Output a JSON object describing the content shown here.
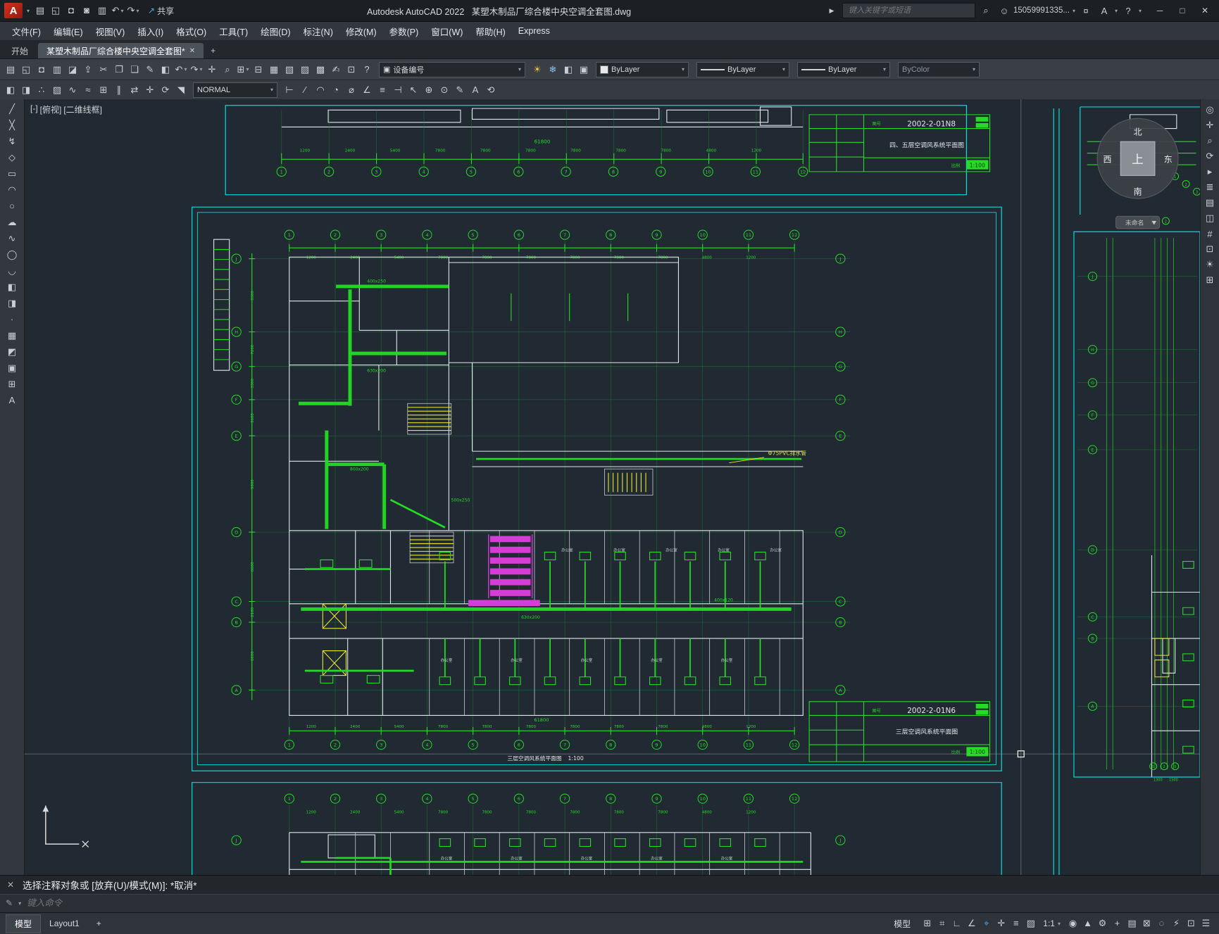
{
  "ui": {
    "caret": "▾",
    "collapse": "▶",
    "close": "✕"
  },
  "titlebar": {
    "logo": "A",
    "app": "Autodesk AutoCAD 2022",
    "doc": "某塑木制品厂综合楼中央空调全套图.dwg",
    "share_icon": "↗",
    "share_label": "共享",
    "search_placeholder": "键入关键字或短语",
    "user": "15059991335...",
    "icons": {
      "search": "⌕",
      "user": "☺",
      "cart": "¤",
      "app": "A",
      "help": "?"
    },
    "quick_icons": [
      {
        "name": "new-icon",
        "glyph": "▤"
      },
      {
        "name": "open-folder-icon",
        "glyph": "◱"
      },
      {
        "name": "save-icon",
        "glyph": "◘"
      },
      {
        "name": "save-as-icon",
        "glyph": "◙"
      },
      {
        "name": "plot-icon",
        "glyph": "▥"
      },
      {
        "name": "undo-icon",
        "glyph": "↶",
        "drop": "▾"
      },
      {
        "name": "redo-icon",
        "glyph": "↷",
        "drop": "▾"
      }
    ],
    "window_controls": [
      {
        "name": "minimize-button",
        "glyph": "─"
      },
      {
        "name": "maximize-button",
        "glyph": "□"
      },
      {
        "name": "close-button",
        "glyph": "✕"
      }
    ]
  },
  "menus": [
    "文件(F)",
    "编辑(E)",
    "视图(V)",
    "插入(I)",
    "格式(O)",
    "工具(T)",
    "绘图(D)",
    "标注(N)",
    "修改(M)",
    "参数(P)",
    "窗口(W)",
    "帮助(H)",
    "Express"
  ],
  "tabs": {
    "start": "开始",
    "doc": "某塑木制品厂综合楼中央空调全套图*",
    "plus": "+"
  },
  "toolbar1": {
    "icons": [
      {
        "name": "qnew-icon",
        "glyph": "▤"
      },
      {
        "name": "open-icon",
        "glyph": "◱"
      },
      {
        "name": "save-icon",
        "glyph": "◘"
      },
      {
        "name": "plot-icon",
        "glyph": "▥"
      },
      {
        "name": "plot-preview-icon",
        "glyph": "◪"
      },
      {
        "name": "publish-icon",
        "glyph": "⇪"
      },
      {
        "name": "cut-icon",
        "glyph": "✂"
      },
      {
        "name": "copy-icon",
        "glyph": "❐"
      },
      {
        "name": "paste-icon",
        "glyph": "❏"
      },
      {
        "name": "match-properties-icon",
        "glyph": "✎"
      },
      {
        "name": "block-editor-icon",
        "glyph": "◧"
      },
      {
        "name": "undo-icon",
        "glyph": "↶",
        "drop": "▾"
      },
      {
        "name": "redo-icon",
        "glyph": "↷",
        "drop": "▾"
      },
      {
        "name": "pan-icon",
        "glyph": "✛"
      },
      {
        "name": "zoom-realtime-icon",
        "glyph": "⌕"
      },
      {
        "name": "zoom-window-icon",
        "glyph": "⊞",
        "drop": "▾"
      },
      {
        "name": "zoom-previous-icon",
        "glyph": "⊟"
      },
      {
        "name": "properties-icon",
        "glyph": "▦"
      },
      {
        "name": "design-center-icon",
        "glyph": "▧"
      },
      {
        "name": "tool-palettes-icon",
        "glyph": "▨"
      },
      {
        "name": "sheet-set-manager-icon",
        "glyph": "▩"
      },
      {
        "name": "markup-set-manager-icon",
        "glyph": "✍"
      },
      {
        "name": "quickcalc-icon",
        "glyph": "⊡"
      },
      {
        "name": "help-icon",
        "glyph": "?"
      }
    ],
    "equipment_icon": "▣",
    "equipment_label": "设备编号",
    "layer_icons": [
      {
        "name": "layer-on-icon",
        "glyph": "☀",
        "color": "#e8c63a"
      },
      {
        "name": "layer-freeze-icon",
        "glyph": "❄",
        "color": "#8cc4ee"
      },
      {
        "name": "layer-lock-icon",
        "glyph": "◧"
      },
      {
        "name": "layer-color-icon",
        "glyph": "▣"
      }
    ],
    "color_value": "ByLayer",
    "linetype_value": "ByLayer",
    "lineweight_value": "ByLayer",
    "plotstyle_value": "ByColor"
  },
  "toolbar2": {
    "icons_a": [
      {
        "name": "insert-block-icon",
        "glyph": "◧"
      },
      {
        "name": "make-block-icon",
        "glyph": "◨"
      },
      {
        "name": "point-style-icon",
        "glyph": "∴"
      },
      {
        "name": "hatch-icon",
        "glyph": "▨"
      },
      {
        "name": "polyline-edit-icon",
        "glyph": "∿"
      },
      {
        "name": "spline-edit-icon",
        "glyph": "≈"
      },
      {
        "name": "array-icon",
        "glyph": "⊞"
      },
      {
        "name": "offset-icon",
        "glyph": "∥"
      },
      {
        "name": "mirror-icon",
        "glyph": "⇄"
      },
      {
        "name": "move-icon",
        "glyph": "✛"
      },
      {
        "name": "rotate-icon",
        "glyph": "⟳"
      },
      {
        "name": "scale-icon",
        "glyph": "◥"
      }
    ],
    "style_value": "NORMAL",
    "icons_b": [
      {
        "name": "dim-linear-icon",
        "glyph": "⊢"
      },
      {
        "name": "dim-aligned-icon",
        "glyph": "∕"
      },
      {
        "name": "dim-arc-icon",
        "glyph": "◠"
      },
      {
        "name": "dim-radius-icon",
        "glyph": "◔"
      },
      {
        "name": "dim-diameter-icon",
        "glyph": "⌀"
      },
      {
        "name": "dim-angular-icon",
        "glyph": "∠"
      },
      {
        "name": "dim-baseline-icon",
        "glyph": "≡"
      },
      {
        "name": "dim-continue-icon",
        "glyph": "⊣"
      },
      {
        "name": "mleader-icon",
        "glyph": "↖"
      },
      {
        "name": "tolerance-icon",
        "glyph": "⊕"
      },
      {
        "name": "center-mark-icon",
        "glyph": "⊙"
      },
      {
        "name": "dim-edit-icon",
        "glyph": "✎"
      },
      {
        "name": "text-edit-icon",
        "glyph": "A"
      },
      {
        "name": "dim-update-icon",
        "glyph": "⟲"
      }
    ]
  },
  "left_tools": [
    {
      "name": "line-icon",
      "glyph": "╱"
    },
    {
      "name": "construction-line-icon",
      "glyph": "╳"
    },
    {
      "name": "polyline-icon",
      "glyph": "↯"
    },
    {
      "name": "polygon-icon",
      "glyph": "◇"
    },
    {
      "name": "rectangle-icon",
      "glyph": "▭"
    },
    {
      "name": "arc-icon",
      "glyph": "◠"
    },
    {
      "name": "circle-icon",
      "glyph": "○"
    },
    {
      "name": "revcloud-icon",
      "glyph": "☁"
    },
    {
      "name": "spline-icon",
      "glyph": "∿"
    },
    {
      "name": "ellipse-icon",
      "glyph": "◯"
    },
    {
      "name": "ellipse-arc-icon",
      "glyph": "◡"
    },
    {
      "name": "insert-block-icon",
      "glyph": "◧"
    },
    {
      "name": "make-block-icon",
      "glyph": "◨"
    },
    {
      "name": "point-icon",
      "glyph": "·"
    },
    {
      "name": "hatch-icon",
      "glyph": "▦"
    },
    {
      "name": "gradient-icon",
      "glyph": "◩"
    },
    {
      "name": "region-icon",
      "glyph": "▣"
    },
    {
      "name": "table-icon",
      "glyph": "⊞"
    },
    {
      "name": "mtext-icon",
      "glyph": "A"
    }
  ],
  "right_tools": [
    {
      "name": "navigation-wheel-icon",
      "glyph": "◎"
    },
    {
      "name": "pan-icon",
      "glyph": "✛"
    },
    {
      "name": "zoom-extents-icon",
      "glyph": "⌕"
    },
    {
      "name": "orbit-icon",
      "glyph": "⟳"
    },
    {
      "name": "show-motion-icon",
      "glyph": "▸"
    },
    {
      "name": "layers-panel-icon",
      "glyph": "≣"
    },
    {
      "name": "properties-panel-icon",
      "glyph": "▤"
    },
    {
      "name": "blocks-panel-icon",
      "glyph": "◫"
    },
    {
      "name": "count-icon",
      "glyph": "#"
    },
    {
      "name": "views-icon",
      "glyph": "⊡"
    },
    {
      "name": "sun-icon",
      "glyph": "☀"
    },
    {
      "name": "grid-panel-icon",
      "glyph": "⊞"
    }
  ],
  "viewport_controls": {
    "min": "[-]",
    "view": "[俯视]",
    "style": "[二维线框]"
  },
  "viewcube": {
    "n": "北",
    "s": "南",
    "w": "西",
    "e": "东",
    "up": "上",
    "view_name": "未命名"
  },
  "drawing": {
    "grid_cols": [
      "1",
      "2",
      "3",
      "4",
      "5",
      "6",
      "7",
      "8",
      "9",
      "10",
      "11",
      "12"
    ],
    "grid_rows": [
      "J",
      "H",
      "G",
      "F",
      "E",
      "D",
      "C",
      "B",
      "A"
    ],
    "row_j": [
      "J"
    ],
    "pair": [
      "1",
      "2"
    ],
    "trio": [
      "1",
      "2",
      "3"
    ],
    "dims_cols": [
      "1200",
      "2400",
      "5400",
      "7800",
      "7800",
      "7800",
      "7800",
      "7800",
      "7800",
      "4800",
      "1200"
    ],
    "dims_total": "61800",
    "dims_rows": [
      "3300",
      "7200",
      "3300",
      "3600",
      "9000",
      "6600",
      "2100",
      "6600"
    ],
    "dims_mini": [
      "1300",
      "1500"
    ],
    "offices": [
      "办公室",
      "办公室",
      "办公室",
      "办公室",
      "办公室"
    ],
    "duct_tags": [
      "400x250",
      "630x200",
      "800x200",
      "500x250",
      "630x200",
      "400x120"
    ],
    "pvc_note": "Φ75PVC排水管",
    "titleblock1": {
      "no_label": "图号",
      "no": "2002-2-01N8",
      "title": "四、五层空调风系统平面图",
      "scale_label": "比例",
      "scale": "1:100"
    },
    "titleblock2": {
      "no_label": "图号",
      "no": "2002-2-01N6",
      "title": "三层空调风系统平面图",
      "scale_label": "比例",
      "scale": "1:100"
    }
  },
  "command": {
    "history": "选择注释对象或 [放弃(U)/模式(M)]: *取消*",
    "prompt": "键入命令",
    "tool_icon": "✎"
  },
  "statusbar": {
    "model_tab": "模型",
    "layout_tab": "Layout1",
    "plus": "+",
    "model_btn": "模型",
    "scale": "1:1",
    "icons_a": [
      {
        "name": "grid-icon",
        "glyph": "⊞"
      },
      {
        "name": "snap-mode-icon",
        "glyph": "⌗"
      },
      {
        "name": "ortho-icon",
        "glyph": "∟"
      },
      {
        "name": "polar-tracking-icon",
        "glyph": "∠"
      },
      {
        "name": "osnap-icon",
        "glyph": "⌖",
        "color": "#4aa3e8"
      },
      {
        "name": "osnap-tracking-icon",
        "glyph": "✛"
      },
      {
        "name": "lineweight-icon",
        "glyph": "≡"
      },
      {
        "name": "transparency-icon",
        "glyph": "▨"
      }
    ],
    "icons_b": [
      {
        "name": "annotation-visibility-icon",
        "glyph": "◉"
      },
      {
        "name": "autoscale-icon",
        "glyph": "▲"
      },
      {
        "name": "workspace-icon",
        "glyph": "⚙"
      },
      {
        "name": "annotation-monitor-icon",
        "glyph": "+"
      },
      {
        "name": "quick-properties-icon",
        "glyph": "▤"
      },
      {
        "name": "lock-ui-icon",
        "glyph": "⊠"
      },
      {
        "name": "isolate-objects-icon",
        "glyph": "◌"
      },
      {
        "name": "graphics-performance-icon",
        "glyph": "⚡"
      },
      {
        "name": "clean-screen-icon",
        "glyph": "⊡"
      },
      {
        "name": "customize-icon",
        "glyph": "☰"
      }
    ]
  }
}
